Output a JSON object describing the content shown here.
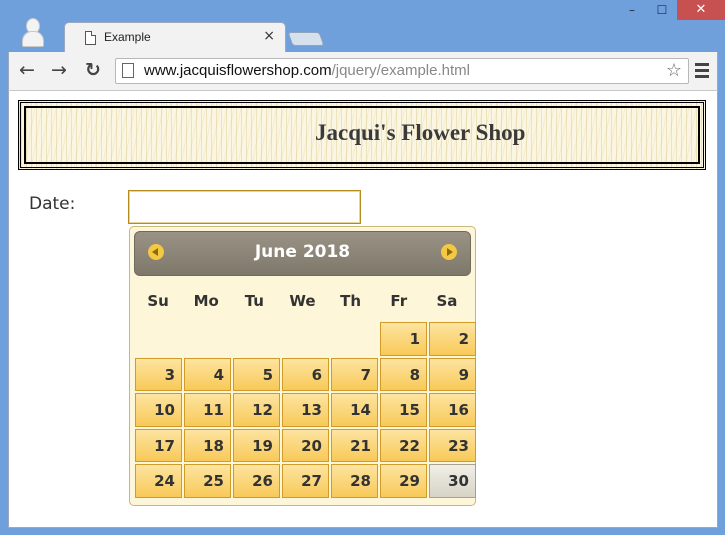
{
  "browser": {
    "tab_title": "Example",
    "tab_close": "×",
    "url_host": "www.jacquisflowershop.com",
    "url_path": "/jquery/example.html",
    "back_glyph": "←",
    "forward_glyph": "→",
    "reload_glyph": "↻",
    "star_glyph": "☆",
    "minimize": "–",
    "maximize": "☐",
    "close": "✕"
  },
  "page": {
    "banner_title": "Jacqui's Flower Shop",
    "date_label": "Date:",
    "date_value": ""
  },
  "datepicker": {
    "month_title": "June 2018",
    "weekdays": [
      "Su",
      "Mo",
      "Tu",
      "We",
      "Th",
      "Fr",
      "Sa"
    ],
    "leading_blanks": 5,
    "days": [
      "1",
      "2",
      "3",
      "4",
      "5",
      "6",
      "7",
      "8",
      "9",
      "10",
      "11",
      "12",
      "13",
      "14",
      "15",
      "16",
      "17",
      "18",
      "19",
      "20",
      "21",
      "22",
      "23",
      "24",
      "25",
      "26",
      "27",
      "28",
      "29",
      "30"
    ],
    "highlighted_day": "30"
  },
  "colors": {
    "day_fill": "#f8c958",
    "header_fill": "#8a8477",
    "calendar_bg": "#fdf6d8"
  }
}
